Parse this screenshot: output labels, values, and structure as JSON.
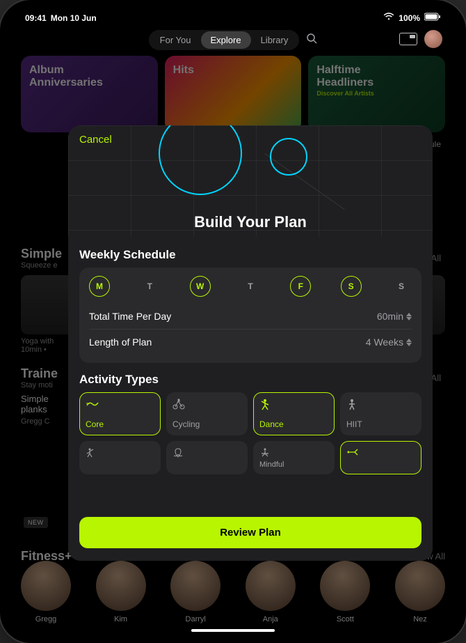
{
  "status": {
    "time": "09:41",
    "date": "Mon 10 Jun",
    "battery": "100%"
  },
  "nav": {
    "tabs": [
      "For You",
      "Explore",
      "Library"
    ],
    "active": 1
  },
  "bg": {
    "music": [
      {
        "title": "Album\nAnniversaries"
      },
      {
        "title": "Hits"
      },
      {
        "title": "Halftime\nHeadliners",
        "sub": "Discover All Artists"
      }
    ],
    "simple": {
      "title": "Simple",
      "sub": "Squeeze e",
      "show": "Show All",
      "caption": "Yoga with",
      "meta": "10min •"
    },
    "trainer_tips": {
      "title": "Traine",
      "sub": "Stay moti",
      "show": "Show All",
      "item1": "Simple",
      "item2": "planks",
      "by": "Gregg C"
    },
    "right_hint": "chedule",
    "new": "NEW",
    "trainers_section": {
      "title": "Fitness+ Trainers",
      "show": "Show All"
    },
    "trainers": [
      "Gregg",
      "Kim",
      "Darryl",
      "Anja",
      "Scott",
      "Nez"
    ]
  },
  "modal": {
    "cancel": "Cancel",
    "title": "Build Your Plan",
    "weekly": "Weekly Schedule",
    "days": [
      {
        "label": "M",
        "selected": true
      },
      {
        "label": "T",
        "selected": false
      },
      {
        "label": "W",
        "selected": true
      },
      {
        "label": "T",
        "selected": false
      },
      {
        "label": "F",
        "selected": true
      },
      {
        "label": "S",
        "selected": true
      },
      {
        "label": "S",
        "selected": false
      }
    ],
    "time_label": "Total Time Per Day",
    "time_val": "60min",
    "length_label": "Length of Plan",
    "length_val": "4 Weeks",
    "activity_head": "Activity Types",
    "activities": [
      {
        "name": "Core",
        "selected": true
      },
      {
        "name": "Cycling",
        "selected": false
      },
      {
        "name": "Dance",
        "selected": true
      },
      {
        "name": "HIIT",
        "selected": false
      }
    ],
    "activities2": [
      {
        "name": "",
        "selected": false
      },
      {
        "name": "",
        "selected": false
      },
      {
        "name": "Mindful",
        "selected": false
      },
      {
        "name": "",
        "selected": true
      }
    ],
    "review": "Review Plan"
  }
}
